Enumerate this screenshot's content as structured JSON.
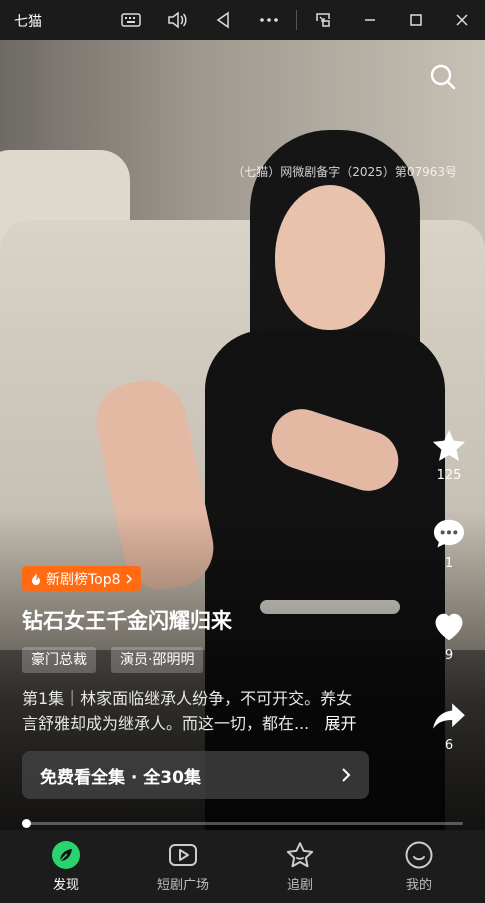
{
  "window": {
    "app_name": "七猫",
    "buttons": [
      "keyboard-icon",
      "volume-icon",
      "back-icon",
      "more-icon",
      "pip-icon",
      "minimize-icon",
      "maximize-icon",
      "close-icon"
    ]
  },
  "video": {
    "license": "（七猫）网微剧备字（2025）第07963号",
    "rank_badge": "新剧榜Top8",
    "title": "钻石女王千金闪耀归来",
    "tags": [
      "豪门总裁",
      "演员·邵明明"
    ],
    "description_line1": "第1集｜林家面临继承人纷争，不可开交。养女",
    "description_line2": "言舒雅却成为继承人。而这一切，都在...",
    "expand_label": "展开",
    "watch_label": "免费看全集 · 全30集",
    "progress": 0
  },
  "actions": [
    {
      "name": "star",
      "count": "125"
    },
    {
      "name": "comment",
      "count": "1"
    },
    {
      "name": "like",
      "count": "9"
    },
    {
      "name": "share",
      "count": "6"
    }
  ],
  "tabs": [
    {
      "label": "发现",
      "active": true
    },
    {
      "label": "短剧广场",
      "active": false
    },
    {
      "label": "追剧",
      "active": false
    },
    {
      "label": "我的",
      "active": false
    }
  ],
  "colors": {
    "accent_green": "#2bd36f",
    "badge_orange": "#ff6a13"
  }
}
